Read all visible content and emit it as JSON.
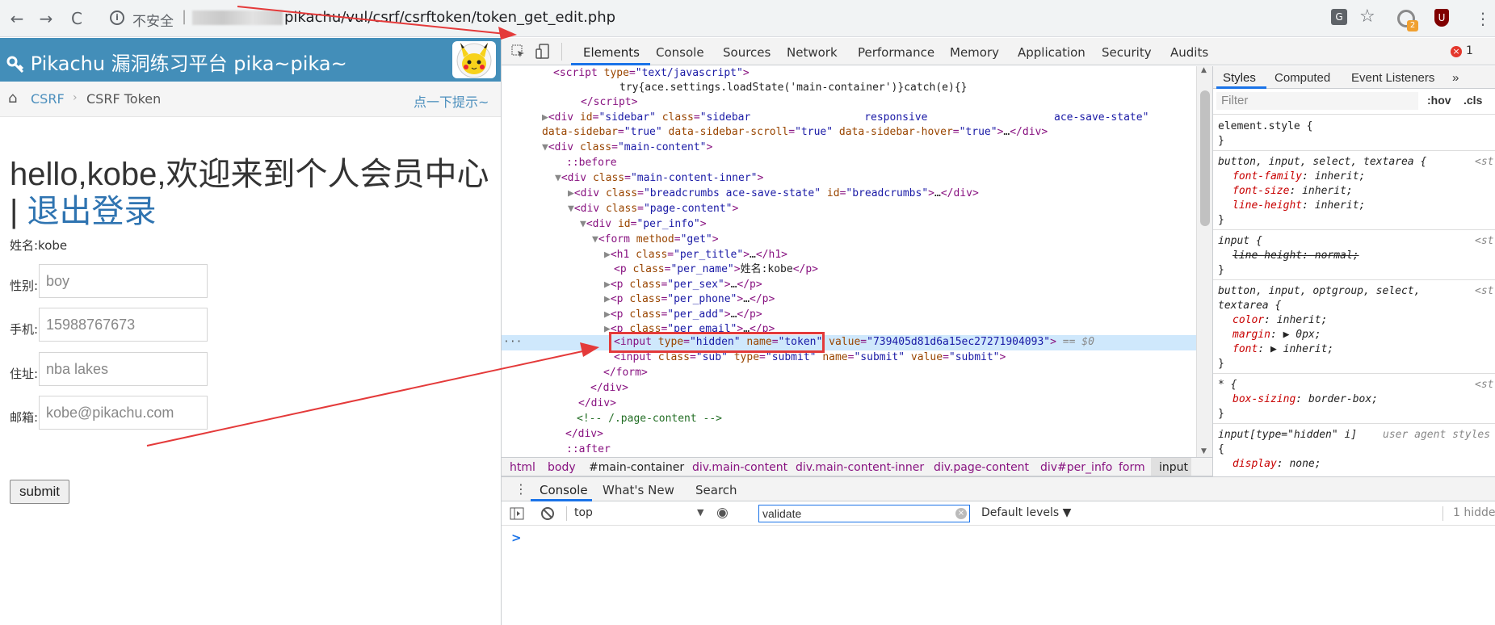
{
  "browser": {
    "back": "←",
    "forward": "→",
    "reload": "C",
    "info_glyph": "i",
    "security_label": "不安全",
    "separator": "|",
    "url": "pikachu/vul/csrf/csrftoken/token_get_edit.php",
    "translate_glyph": "G",
    "star_glyph": "☆",
    "ext_badge": "2",
    "shield_glyph": "U",
    "menu_glyph": "⋮"
  },
  "page": {
    "brand": "Pikachu 漏洞练习平台 pika~pika~",
    "breadcrumb": {
      "home_glyph": "⌂",
      "section": "CSRF",
      "sep": "›",
      "current": "CSRF Token",
      "hint": "点一下提示~"
    },
    "title_prefix": "hello,kobe,欢迎来到个人会员中心 | ",
    "logout": "退出登录",
    "name_line": "姓名:kobe",
    "fields": [
      {
        "label": "性别:",
        "value": "boy"
      },
      {
        "label": "手机:",
        "value": "15988767673"
      },
      {
        "label": "住址:",
        "value": "nba lakes"
      },
      {
        "label": "邮箱:",
        "value": "kobe@pikachu.com"
      }
    ],
    "submit": "submit"
  },
  "devtools": {
    "tabs": [
      "Elements",
      "Console",
      "Sources",
      "Network",
      "Performance",
      "Memory",
      "Application",
      "Security",
      "Audits"
    ],
    "errors": "1",
    "breadcrumbs": [
      "html",
      "body",
      "#main-container",
      "div.main-content",
      "div.main-content-inner",
      "div.page-content",
      "div#per_info",
      "form",
      "input"
    ],
    "token_value": "739405d81d6a15ec27271904093",
    "styles_tabs": [
      "Styles",
      "Computed",
      "Event Listeners",
      "»"
    ],
    "filter_placeholder": "Filter",
    "hov": ":hov",
    "cls": ".cls",
    "drawer_tabs": [
      "Console",
      "What's New",
      "Search"
    ],
    "context": "top",
    "console_filter": "validate",
    "levels": "Default levels ▼",
    "hidden_count": "1 hidde",
    "prompt": ">"
  },
  "colors": {
    "navbar": "#438eb9",
    "annotation": "#e43a3a",
    "selected_row": "#cfe8fc"
  }
}
